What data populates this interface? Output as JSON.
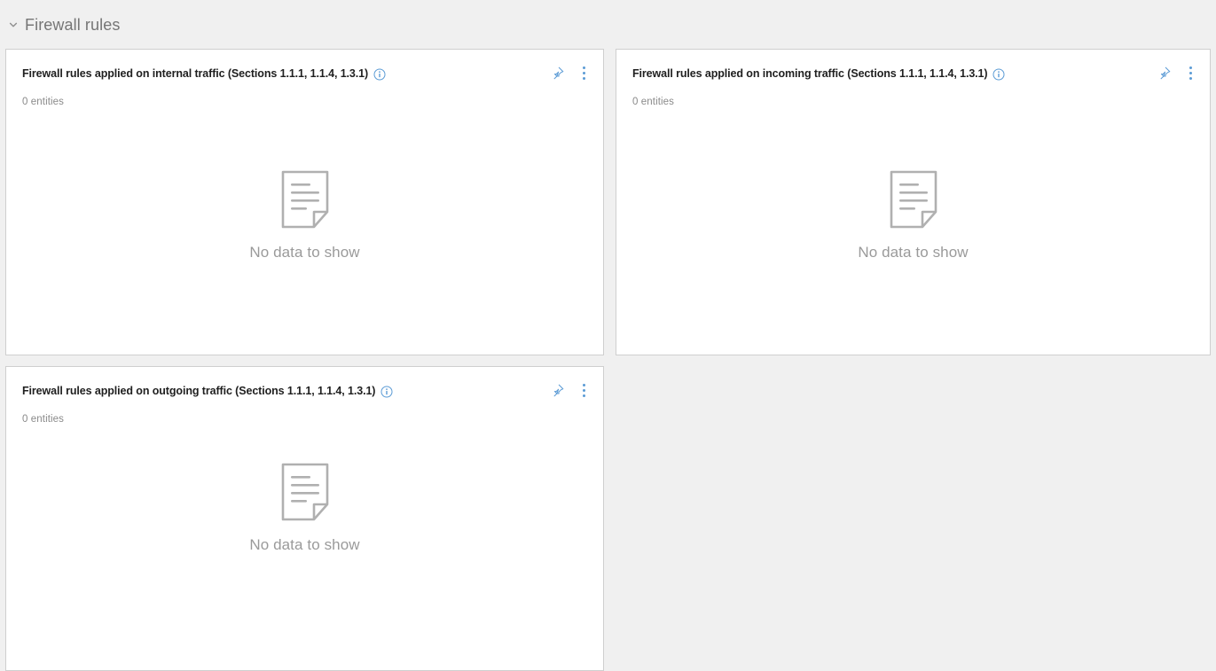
{
  "section": {
    "title": "Firewall rules",
    "collapse_icon": "chevron-down-icon",
    "expanded": true
  },
  "colors": {
    "page_background": "#f0f0f0",
    "card_background": "#ffffff",
    "card_border": "#cfcfcf",
    "accent_blue": "#5b9bd5",
    "info_blue": "#5b9bd5",
    "title_text": "#1f1f1f",
    "muted_text": "#8a8a8a",
    "empty_text": "#9a9a9a",
    "section_title_text": "#767676"
  },
  "common": {
    "pin_icon": "pin-icon",
    "more_icon": "more-options-icon",
    "info_icon": "info-icon",
    "empty_icon": "document-icon",
    "empty_message": "No data to show"
  },
  "cards": [
    {
      "id": "internal-traffic",
      "title": "Firewall rules applied on internal traffic (Sections 1.1.1, 1.1.4, 1.3.1)",
      "entity_count": "0 entities",
      "empty_message": "No data to show"
    },
    {
      "id": "incoming-traffic",
      "title": "Firewall rules applied on incoming traffic (Sections 1.1.1, 1.1.4, 1.3.1)",
      "entity_count": "0 entities",
      "empty_message": "No data to show"
    },
    {
      "id": "outgoing-traffic",
      "title": "Firewall rules applied on outgoing traffic (Sections 1.1.1, 1.1.4, 1.3.1)",
      "entity_count": "0 entities",
      "empty_message": "No data to show"
    }
  ]
}
